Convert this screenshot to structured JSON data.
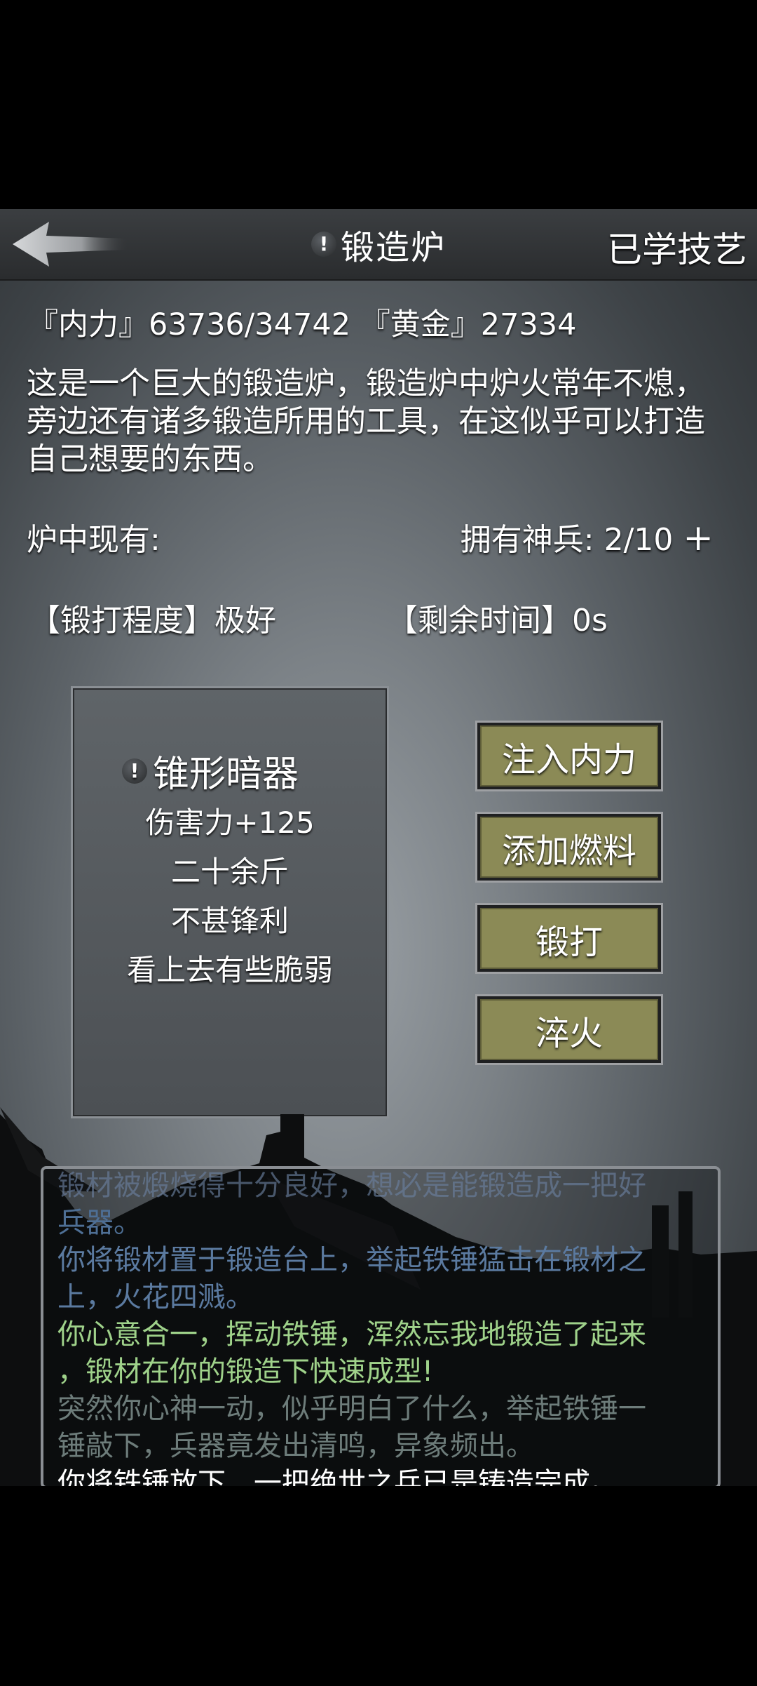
{
  "header": {
    "title": "锻造炉",
    "right_link": "已学技艺"
  },
  "stats": {
    "text": "『内力』63736/34742 『黄金』27334"
  },
  "description": "这是一个巨大的锻造炉，锻造炉中炉火常年不熄，旁边还有诸多锻造所用的工具，在这似乎可以打造自己想要的东西。",
  "furnace": {
    "contents_label": "炉中现有:",
    "divine_weapons": "拥有神兵: 2/10",
    "plus": "+"
  },
  "forging": {
    "degree": "【锻打程度】极好",
    "time_left": "【剩余时间】0s"
  },
  "weapon": {
    "name": "锥形暗器",
    "lines": [
      "伤害力+125",
      "二十余斤",
      "不甚锋利",
      "看上去有些脆弱"
    ]
  },
  "actions": [
    "注入内力",
    "添加燃料",
    "锻打",
    "淬火"
  ],
  "log": [
    {
      "text": "锻材被煅烧得十分良好，想必是能锻造成一把好",
      "color": "faded"
    },
    {
      "text": "兵器。",
      "color": "blue"
    },
    {
      "text": "你将锻材置于锻造台上，举起铁锤猛击在锻材之",
      "color": "blue2"
    },
    {
      "text": "上，火花四溅。",
      "color": "blue2"
    },
    {
      "text": "你心意合一，挥动铁锤，浑然忘我地锻造了起来",
      "color": "green"
    },
    {
      "text": "，锻材在你的锻造下快速成型!",
      "color": "green"
    },
    {
      "text": "突然你心神一动，似乎明白了什么，举起铁锤一",
      "color": "grey"
    },
    {
      "text": "锤敲下，兵器竟发出清鸣，异象频出。",
      "color": "grey"
    },
    {
      "text": "你将铁锤放下，一把绝世之兵已是铸造完成。",
      "color": "white"
    }
  ]
}
